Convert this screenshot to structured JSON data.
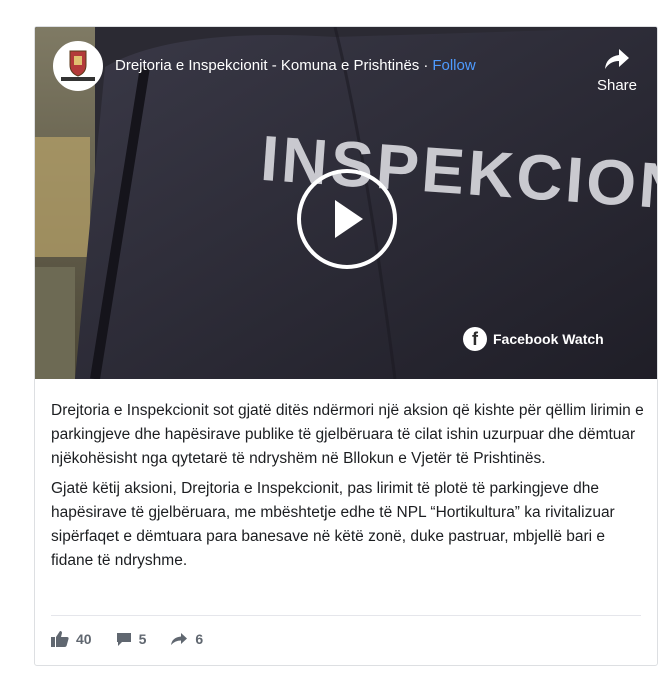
{
  "post": {
    "page_name": "Drejtoria e Inspekcionit - Komuna e Prishtinës",
    "separator": "·",
    "follow_label": "Follow",
    "share_label": "Share",
    "avatar_text": "INSPEKCIONI",
    "video_jacket_text": "INSPEKCION",
    "watch_label": "Facebook Watch",
    "paragraphs": [
      "Drejtoria e Inspekcionit sot gjatë ditës ndërmori një aksion që kishte për qëllim lirimin e parkingjeve dhe hapësirave publike të gjelbëruara të cilat ishin uzurpuar dhe dëmtuar njëkohësisht nga qytetarë të ndryshëm në Bllokun e Vjetër të Prishtinës.",
      "Gjatë këtij aksioni, Drejtoria e Inspekcionit, pas lirimit të plotë të parkingjeve dhe hapësirave të gjelbëruara, me mbështetje edhe të NPL “Hortikultura” ka rivitalizuar sipërfaqet e dëmtuara para banesave në këtë zonë, duke pastruar, mbjellë bari e fidane të ndryshme."
    ],
    "reactions": {
      "likes": "40",
      "comments": "5",
      "shares": "6"
    }
  },
  "icons": [
    "like-icon",
    "comment-icon",
    "share-icon",
    "play-icon",
    "facebook-logo-icon"
  ],
  "colors": {
    "follow": "#4e9bff",
    "text": "#1c1e21",
    "meta": "#606770"
  }
}
